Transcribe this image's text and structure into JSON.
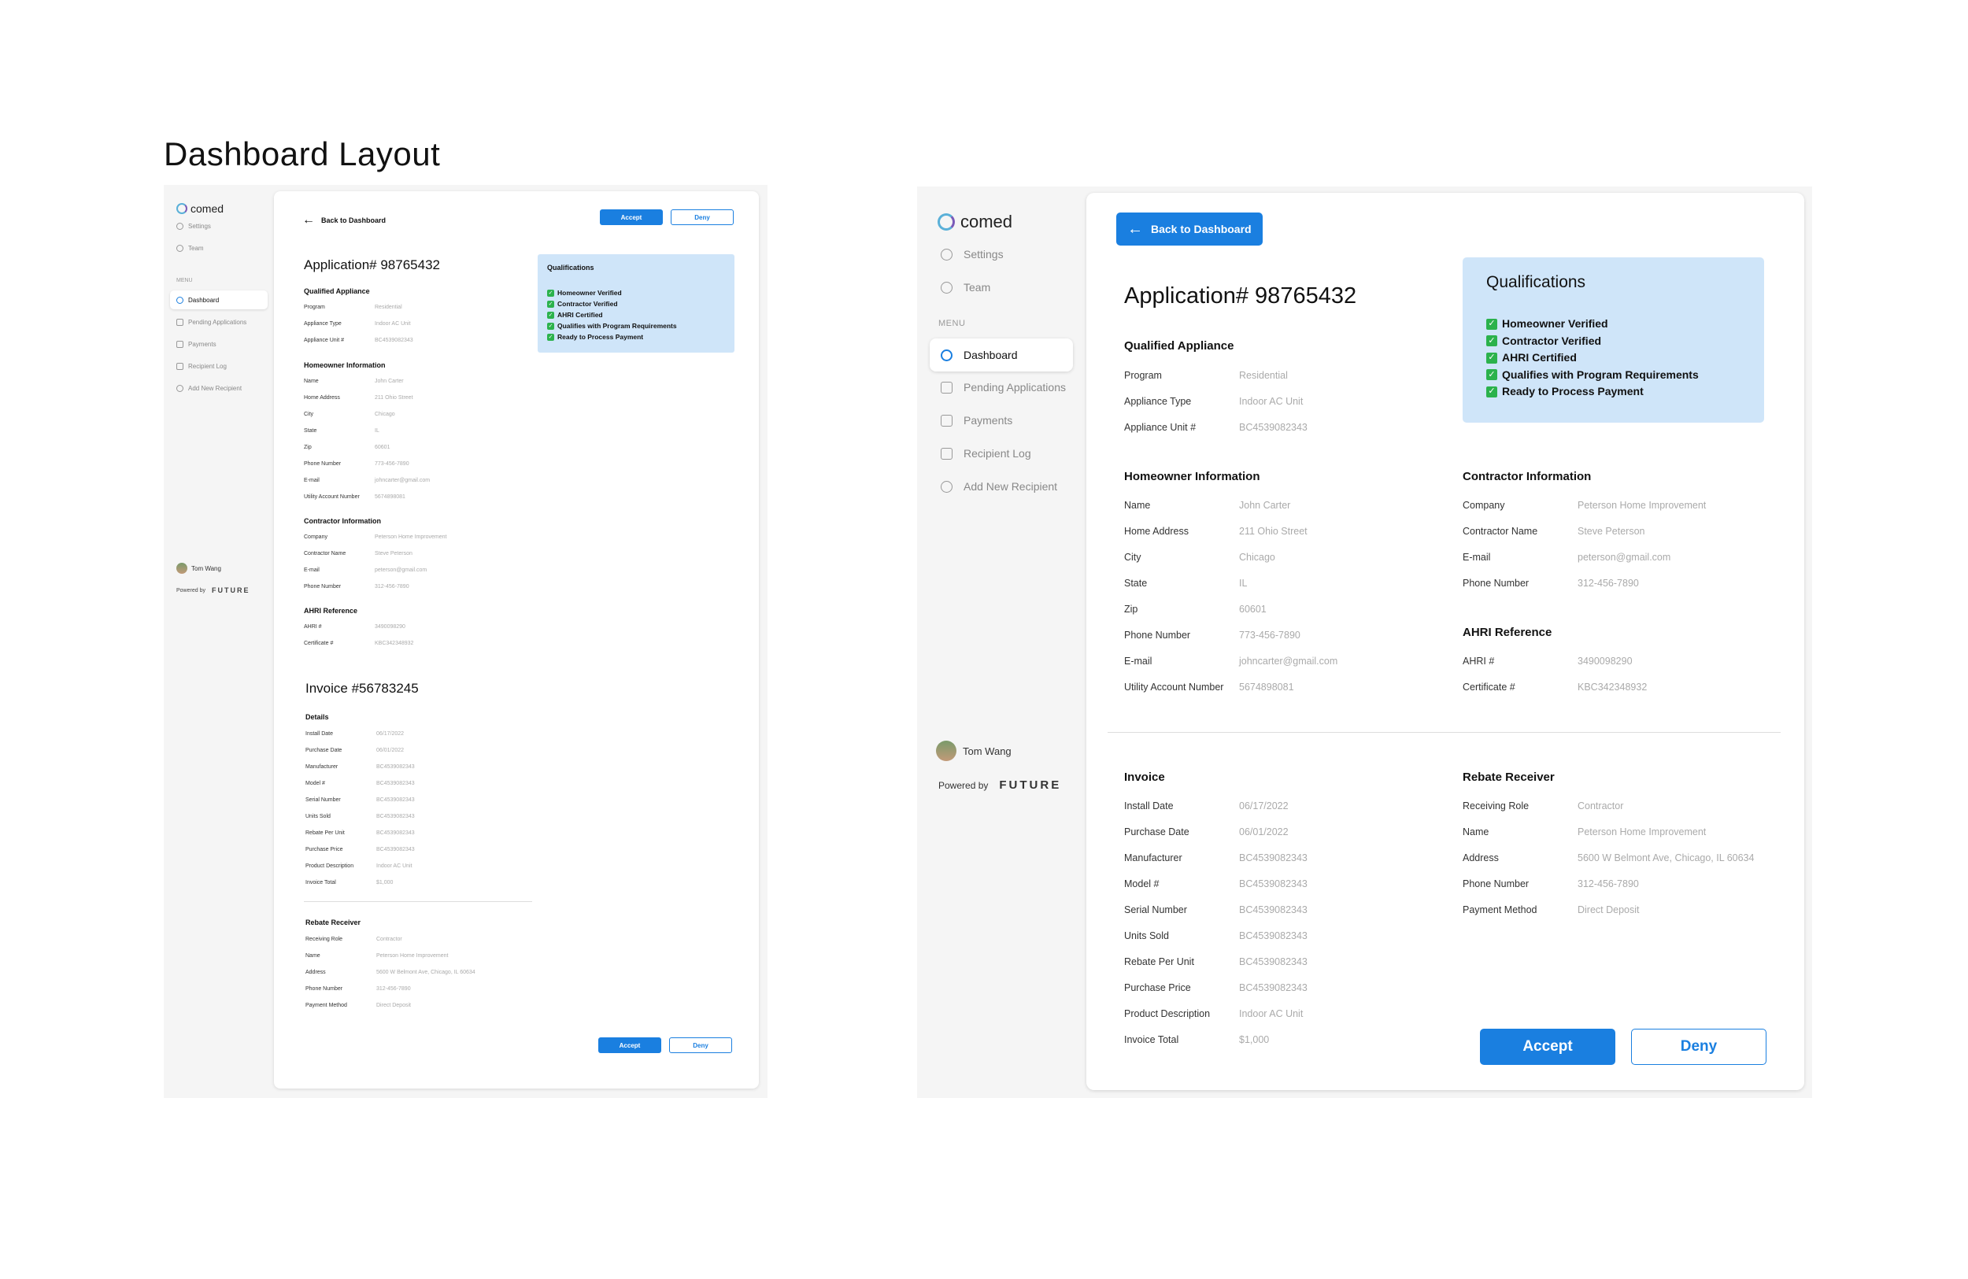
{
  "heading": "Dashboard Layout",
  "brand": {
    "logo_text": "comed"
  },
  "sidebar": {
    "settings": "Settings",
    "team": "Team",
    "menu_header": "MENU",
    "items": [
      {
        "label": "Dashboard",
        "icon": "compass-icon",
        "active": true
      },
      {
        "label": "Pending Applications",
        "icon": "document-icon"
      },
      {
        "label": "Payments",
        "icon": "payments-icon"
      },
      {
        "label": "Recipient Log",
        "icon": "layers-icon"
      },
      {
        "label": "Add New Recipient",
        "icon": "add-user-icon"
      }
    ],
    "user_name": "Tom Wang",
    "powered_by": "Powered by",
    "powered_brand": "FUTURE"
  },
  "actions": {
    "back": "Back to Dashboard",
    "accept": "Accept",
    "deny": "Deny"
  },
  "application": {
    "title": "Application# 98765432",
    "qualified_appliance": {
      "heading": "Qualified Appliance",
      "rows": [
        {
          "label": "Program",
          "value": "Residential"
        },
        {
          "label": "Appliance Type",
          "value": "Indoor AC Unit"
        },
        {
          "label": "Appliance Unit #",
          "value": "BC4539082343"
        }
      ]
    },
    "homeowner": {
      "heading": "Homeowner Information",
      "rows": [
        {
          "label": "Name",
          "value": "John Carter"
        },
        {
          "label": "Home Address",
          "value": "211 Ohio Street"
        },
        {
          "label": "City",
          "value": "Chicago"
        },
        {
          "label": "State",
          "value": "IL"
        },
        {
          "label": "Zip",
          "value": "60601"
        },
        {
          "label": "Phone Number",
          "value": "773-456-7890"
        },
        {
          "label": "E-mail",
          "value": "johncarter@gmail.com"
        },
        {
          "label": "Utility Account Number",
          "value": "5674898081"
        }
      ]
    },
    "contractor": {
      "heading": "Contractor Information",
      "rows": [
        {
          "label": "Company",
          "value": "Peterson Home Improvement"
        },
        {
          "label": "Contractor Name",
          "value": "Steve Peterson"
        },
        {
          "label": "E-mail",
          "value": "peterson@gmail.com"
        },
        {
          "label": "Phone Number",
          "value": "312-456-7890"
        }
      ]
    },
    "ahri": {
      "heading": "AHRI Reference",
      "rows": [
        {
          "label": "AHRI #",
          "value": "3490098290"
        },
        {
          "label": "Certificate #",
          "value": "KBC342348932"
        }
      ]
    }
  },
  "qualifications": {
    "title": "Qualifications",
    "items": [
      "Homeowner Verified",
      "Contractor Verified",
      "AHRI Certified",
      "Qualifies with Program Requirements",
      "Ready to Process Payment"
    ]
  },
  "invoice": {
    "title": "Invoice #56783245",
    "details_heading": "Details",
    "heading": "Invoice",
    "rows": [
      {
        "label": "Install Date",
        "value": "06/17/2022"
      },
      {
        "label": "Purchase Date",
        "value": "06/01/2022"
      },
      {
        "label": "Manufacturer",
        "value": "BC4539082343"
      },
      {
        "label": "Model #",
        "value": "BC4539082343"
      },
      {
        "label": "Serial Number",
        "value": "BC4539082343"
      },
      {
        "label": "Units Sold",
        "value": "BC4539082343"
      },
      {
        "label": "Rebate Per Unit",
        "value": "BC4539082343"
      },
      {
        "label": "Purchase Price",
        "value": "BC4539082343"
      },
      {
        "label": "Product Description",
        "value": "Indoor AC Unit"
      },
      {
        "label": "Invoice Total",
        "value": "$1,000"
      }
    ]
  },
  "rebate_receiver": {
    "heading": "Rebate Receiver",
    "rows": [
      {
        "label": "Receiving Role",
        "value": "Contractor"
      },
      {
        "label": "Name",
        "value": "Peterson Home Improvement"
      },
      {
        "label": "Address",
        "value": "5600 W Belmont Ave, Chicago, IL 60634"
      },
      {
        "label": "Phone Number",
        "value": "312-456-7890"
      },
      {
        "label": "Payment Method",
        "value": "Direct Deposit"
      }
    ]
  },
  "colors": {
    "accent": "#1a7fe0",
    "qual_bg": "#cfe5f9",
    "check": "#2bb24c",
    "muted": "#aaaaaa"
  }
}
